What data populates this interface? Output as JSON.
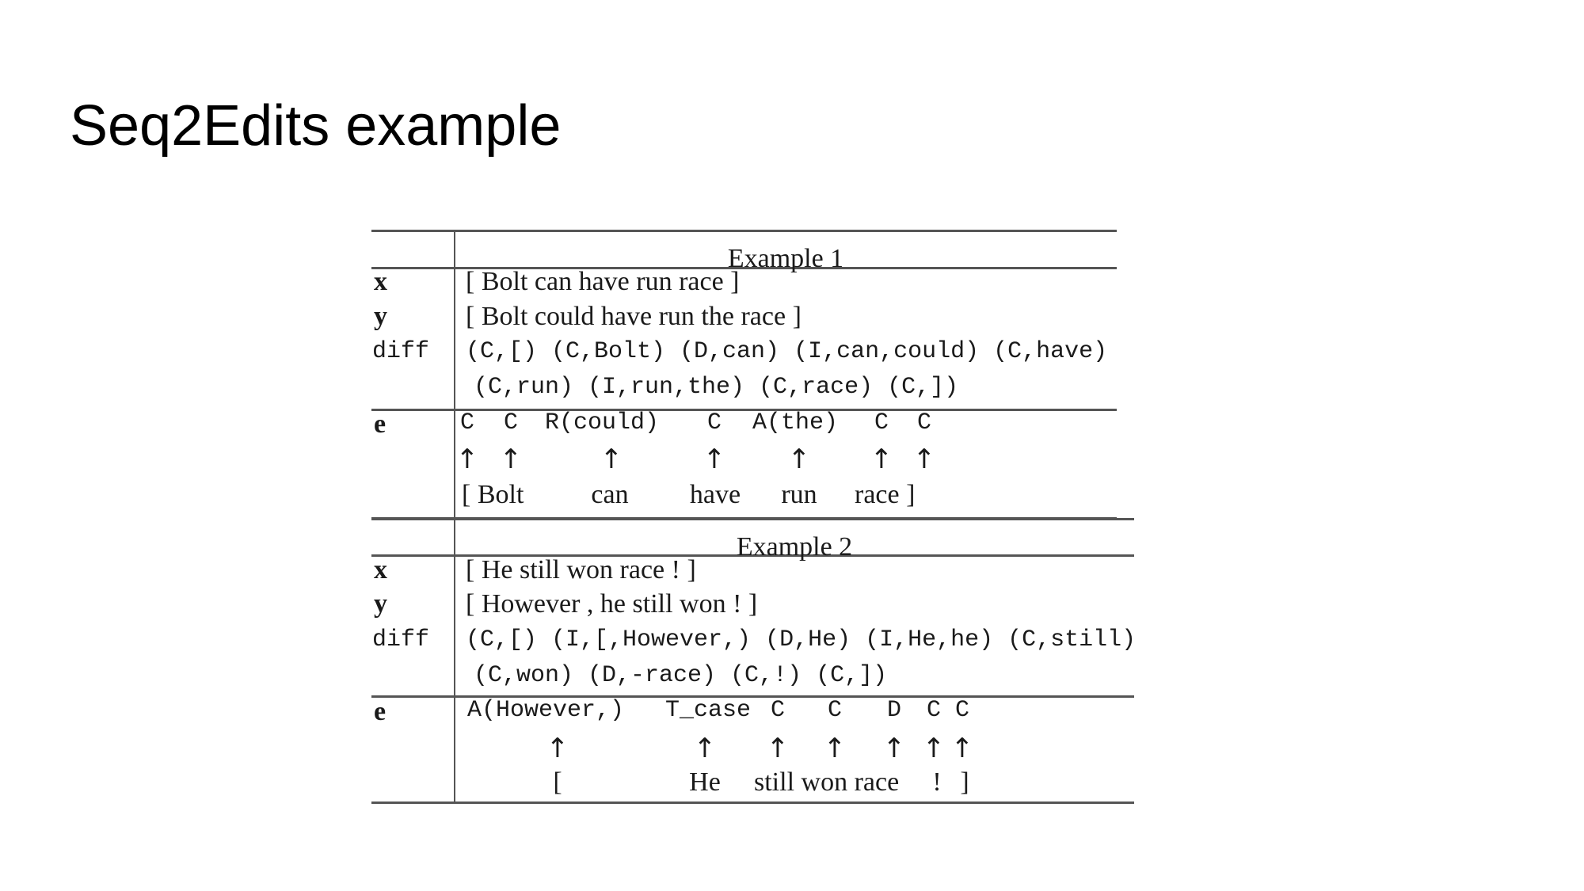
{
  "slide": {
    "title": "Seq2Edits example"
  },
  "table": {
    "examples": [
      {
        "header": "Example 1",
        "labels": {
          "x": "x",
          "y": "y",
          "diff": "diff",
          "e": "e"
        },
        "x": "[ Bolt can have run race ]",
        "y": "[ Bolt could have run the race ]",
        "diff_line1": "(C,[) (C,Bolt) (D,can) (I,can,could) (C,have)",
        "diff_line2": "(C,run) (I,run,the) (C,race) (C,])",
        "edits": [
          "C",
          "C",
          "R(could)",
          "C",
          "A(the)",
          "C",
          "C"
        ],
        "arrow": "↑",
        "source_tokens": [
          "[ Bolt",
          "can",
          "have",
          "run",
          "race ]"
        ]
      },
      {
        "header": "Example 2",
        "labels": {
          "x": "x",
          "y": "y",
          "diff": "diff",
          "e": "e"
        },
        "x": "[ He still won race ! ]",
        "y": "[ However , he still won ! ]",
        "diff_line1": "(C,[) (I,[,However,) (D,He) (I,He,he) (C,still)",
        "diff_line2": "(C,won) (D,-race)  (C,!)   (C,])",
        "edits": [
          "A(However,)",
          "T_case",
          "C",
          "C",
          "D",
          "C",
          "C"
        ],
        "arrow": "↑",
        "source_tokens": [
          "[",
          "He",
          "still won race",
          "!",
          "]"
        ]
      }
    ]
  }
}
